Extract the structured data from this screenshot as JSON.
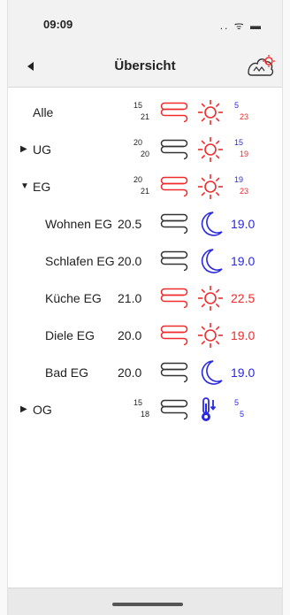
{
  "status": {
    "time": "09:09",
    "icons": ".. ᯤ ▬"
  },
  "nav": {
    "title": "Übersicht"
  },
  "colors": {
    "red": "#ef2b2b",
    "blue": "#2a2ae0",
    "dark": "#333333"
  },
  "rows": [
    {
      "label": "Alle",
      "level": 0,
      "expander": "",
      "set_a": "15",
      "set_b": "21",
      "value": "",
      "heater": "red",
      "mode": "sun",
      "temp": "",
      "temp_a": "5",
      "temp_b": "23"
    },
    {
      "label": "UG",
      "level": 0,
      "expander": "▶",
      "set_a": "20",
      "set_b": "20",
      "value": "",
      "heater": "dark",
      "mode": "sun",
      "temp": "",
      "temp_a": "15",
      "temp_b": "19"
    },
    {
      "label": "EG",
      "level": 0,
      "expander": "▼",
      "set_a": "20",
      "set_b": "21",
      "value": "",
      "heater": "red",
      "mode": "sun",
      "temp": "",
      "temp_a": "19",
      "temp_b": "23"
    },
    {
      "label": "Wohnen EG",
      "level": 1,
      "expander": "",
      "set_a": "",
      "set_b": "",
      "value": "20.5",
      "heater": "dark",
      "mode": "moon",
      "temp": "19.0",
      "temp_color": "blue"
    },
    {
      "label": "Schlafen EG",
      "level": 1,
      "expander": "",
      "set_a": "",
      "set_b": "",
      "value": "20.0",
      "heater": "dark",
      "mode": "moon",
      "temp": "19.0",
      "temp_color": "blue"
    },
    {
      "label": "Küche EG",
      "level": 1,
      "expander": "",
      "set_a": "",
      "set_b": "",
      "value": "21.0",
      "heater": "red",
      "mode": "sun",
      "temp": "22.5",
      "temp_color": "red"
    },
    {
      "label": "Diele EG",
      "level": 1,
      "expander": "",
      "set_a": "",
      "set_b": "",
      "value": "20.0",
      "heater": "red",
      "mode": "sun",
      "temp": "19.0",
      "temp_color": "red"
    },
    {
      "label": "Bad EG",
      "level": 1,
      "expander": "",
      "set_a": "",
      "set_b": "",
      "value": "20.0",
      "heater": "dark",
      "mode": "moon",
      "temp": "19.0",
      "temp_color": "blue"
    },
    {
      "label": "OG",
      "level": 0,
      "expander": "▶",
      "set_a": "15",
      "set_b": "18",
      "value": "",
      "heater": "dark",
      "mode": "thermometer",
      "temp": "",
      "temp_a": "5",
      "temp_b": "5"
    }
  ]
}
